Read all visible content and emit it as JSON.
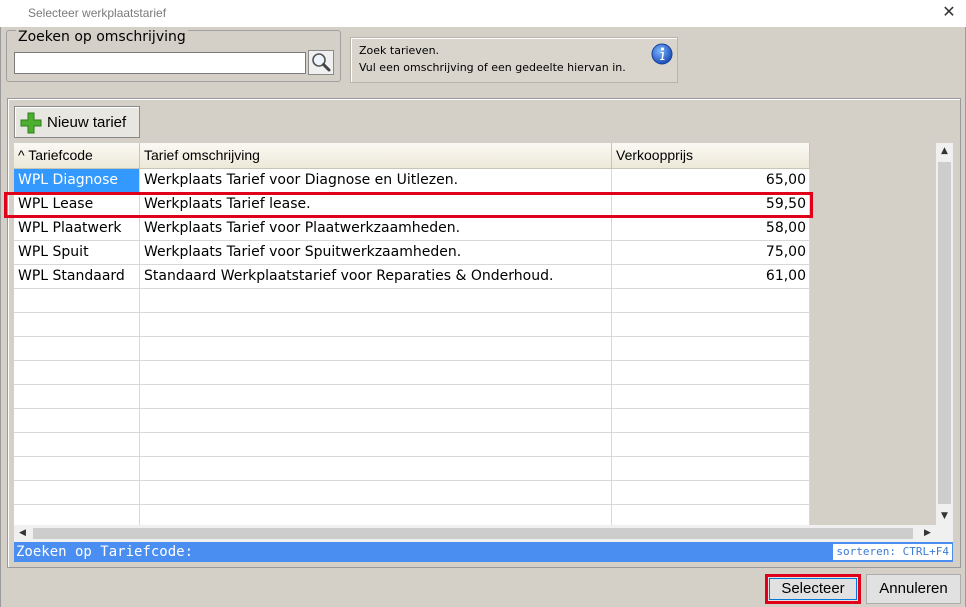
{
  "window": {
    "title": "Selecteer werkplaatstarief",
    "close_glyph": "✕"
  },
  "search": {
    "legend": "Zoeken op omschrijving",
    "value": "",
    "button_icon": "magnifier-icon"
  },
  "info": {
    "line1": "Zoek tarieven.",
    "line2": "Vul een omschrijving of een gedeelte hiervan in.",
    "icon": "info-icon"
  },
  "toolbar": {
    "new_label": "Nieuw tarief",
    "new_icon": "plus-icon"
  },
  "table": {
    "columns": [
      {
        "label": "^ Tariefcode"
      },
      {
        "label": "Tarief omschrijving"
      },
      {
        "label": "Verkoopprijs"
      }
    ],
    "rows": [
      {
        "code": "WPL Diagnose",
        "desc": "Werkplaats Tarief voor Diagnose en Uitlezen.",
        "price": "65,00"
      },
      {
        "code": "WPL Lease",
        "desc": "Werkplaats Tarief lease.",
        "price": "59,50"
      },
      {
        "code": "WPL Plaatwerk",
        "desc": "Werkplaats Tarief voor Plaatwerkzaamheden.",
        "price": "58,00"
      },
      {
        "code": "WPL Spuit",
        "desc": "Werkplaats Tarief voor Spuitwerkzaamheden.",
        "price": "75,00"
      },
      {
        "code": "WPL Standaard",
        "desc": "Standaard Werkplaatstarief voor Reparaties & Onderhoud.",
        "price": "61,00"
      }
    ],
    "selected_row": 0,
    "highlighted_row": 1
  },
  "status": {
    "label": "Zoeken op Tariefcode:",
    "hint": "sorteren: CTRL+F4"
  },
  "buttons": {
    "select": "Selecteer",
    "cancel": "Annuleren"
  },
  "colors": {
    "selection": "#3399ff",
    "highlight": "#e0001a",
    "status_bar": "#4a8ef2"
  }
}
